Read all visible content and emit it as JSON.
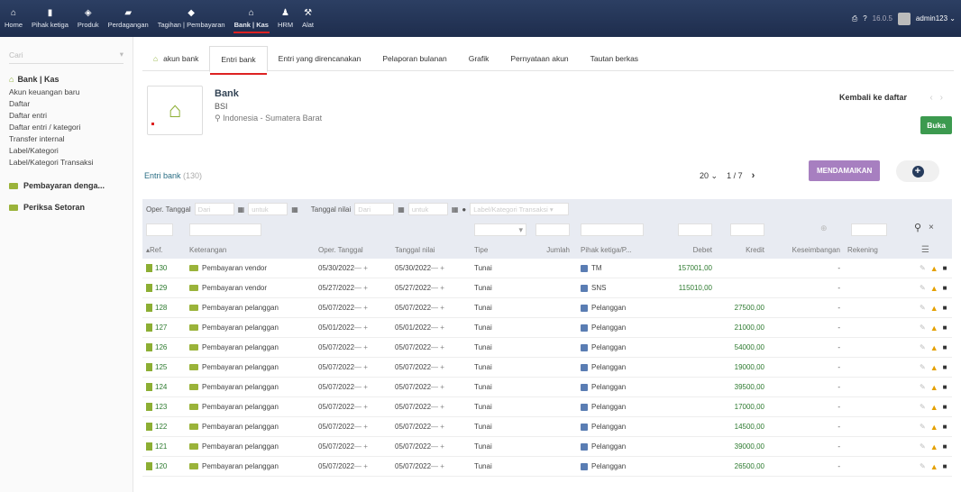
{
  "topnav": [
    {
      "label": "Home",
      "icon": "home-icon",
      "glyph": "⌂",
      "active": false
    },
    {
      "label": "Pihak ketiga",
      "icon": "building-icon",
      "glyph": "▮",
      "active": false
    },
    {
      "label": "Produk",
      "icon": "cube-icon",
      "glyph": "◈",
      "active": false
    },
    {
      "label": "Perdagangan",
      "icon": "briefcase-icon",
      "glyph": "▰",
      "active": false
    },
    {
      "label": "Tagihan | Pembayaran",
      "icon": "money-icon",
      "glyph": "◆",
      "active": false
    },
    {
      "label": "Bank | Kas",
      "icon": "bank-icon",
      "glyph": "⌂",
      "active": true
    },
    {
      "label": "HRM",
      "icon": "user-icon",
      "glyph": "♟",
      "active": false
    },
    {
      "label": "Alat",
      "icon": "wrench-icon",
      "glyph": "⚒",
      "active": false
    }
  ],
  "topright": {
    "version": "16.0.5",
    "user": "admin123"
  },
  "sidebar": {
    "search_placeholder": "Cari",
    "section_title": "Bank | Kas",
    "items": [
      "Akun keuangan baru",
      "Daftar",
      "Daftar entri",
      "Daftar entri / kategori",
      "Transfer internal",
      "Label/Kategori",
      "Label/Kategori Transaksi"
    ],
    "section2": "Pembayaran denga...",
    "section3": "Periksa Setoran"
  },
  "tabs": [
    "akun bank",
    "Entri bank",
    "Entri yang direncanakan",
    "Pelaporan bulanan",
    "Grafik",
    "Pernyataan akun",
    "Tautan berkas"
  ],
  "bank": {
    "title": "Bank",
    "code": "BSI",
    "location": "Indonesia - Sumatera Barat"
  },
  "header_actions": {
    "back": "Kembali ke daftar",
    "open": "Buka"
  },
  "list": {
    "title": "Entri bank",
    "count": "(130)",
    "per_page": "20",
    "page": "1",
    "sep": "/",
    "pages": "7",
    "reconcile": "MENDAMAIKAN"
  },
  "filters": {
    "oper_tanggal": "Oper. Tanggal",
    "from": "Dari",
    "to": "untuk",
    "tanggal_nilai": "Tanggal nilai",
    "from2": "Dari",
    "to2": "untuk",
    "category_placeholder": "Label/Kategori Transaksi"
  },
  "columns": [
    "Ref.",
    "Keterangan",
    "Oper. Tanggal",
    "Tanggal nilai",
    "Tipe",
    "Jumlah",
    "Pihak ketiga/P...",
    "Debet",
    "Kredit",
    "Keseimbangan",
    "Rekening"
  ],
  "rows": [
    {
      "ref": "130",
      "desc": "Pembayaran vendor",
      "op": "05/30/2022",
      "val": "05/30/2022",
      "type": "Tunai",
      "tp": "TM",
      "debit": "157001,00",
      "credit": "",
      "bal": "-"
    },
    {
      "ref": "129",
      "desc": "Pembayaran vendor",
      "op": "05/27/2022",
      "val": "05/27/2022",
      "type": "Tunai",
      "tp": "SNS",
      "debit": "115010,00",
      "credit": "",
      "bal": "-"
    },
    {
      "ref": "128",
      "desc": "Pembayaran pelanggan",
      "op": "05/07/2022",
      "val": "05/07/2022",
      "type": "Tunai",
      "tp": "Pelanggan",
      "debit": "",
      "credit": "27500,00",
      "bal": "-"
    },
    {
      "ref": "127",
      "desc": "Pembayaran pelanggan",
      "op": "05/01/2022",
      "val": "05/01/2022",
      "type": "Tunai",
      "tp": "Pelanggan",
      "debit": "",
      "credit": "21000,00",
      "bal": "-"
    },
    {
      "ref": "126",
      "desc": "Pembayaran pelanggan",
      "op": "05/07/2022",
      "val": "05/07/2022",
      "type": "Tunai",
      "tp": "Pelanggan",
      "debit": "",
      "credit": "54000,00",
      "bal": "-"
    },
    {
      "ref": "125",
      "desc": "Pembayaran pelanggan",
      "op": "05/07/2022",
      "val": "05/07/2022",
      "type": "Tunai",
      "tp": "Pelanggan",
      "debit": "",
      "credit": "19000,00",
      "bal": "-"
    },
    {
      "ref": "124",
      "desc": "Pembayaran pelanggan",
      "op": "05/07/2022",
      "val": "05/07/2022",
      "type": "Tunai",
      "tp": "Pelanggan",
      "debit": "",
      "credit": "39500,00",
      "bal": "-"
    },
    {
      "ref": "123",
      "desc": "Pembayaran pelanggan",
      "op": "05/07/2022",
      "val": "05/07/2022",
      "type": "Tunai",
      "tp": "Pelanggan",
      "debit": "",
      "credit": "17000,00",
      "bal": "-"
    },
    {
      "ref": "122",
      "desc": "Pembayaran pelanggan",
      "op": "05/07/2022",
      "val": "05/07/2022",
      "type": "Tunai",
      "tp": "Pelanggan",
      "debit": "",
      "credit": "14500,00",
      "bal": "-"
    },
    {
      "ref": "121",
      "desc": "Pembayaran pelanggan",
      "op": "05/07/2022",
      "val": "05/07/2022",
      "type": "Tunai",
      "tp": "Pelanggan",
      "debit": "",
      "credit": "39000,00",
      "bal": "-"
    },
    {
      "ref": "120",
      "desc": "Pembayaran pelanggan",
      "op": "05/07/2022",
      "val": "05/07/2022",
      "type": "Tunai",
      "tp": "Pelanggan",
      "debit": "",
      "credit": "26500,00",
      "bal": "-"
    }
  ],
  "colors": {
    "accent": "#d22222",
    "topbar": "#2c3f63",
    "reconcile": "#a77fc0",
    "open": "#3c9a4f",
    "amount": "#2d7a2f"
  }
}
